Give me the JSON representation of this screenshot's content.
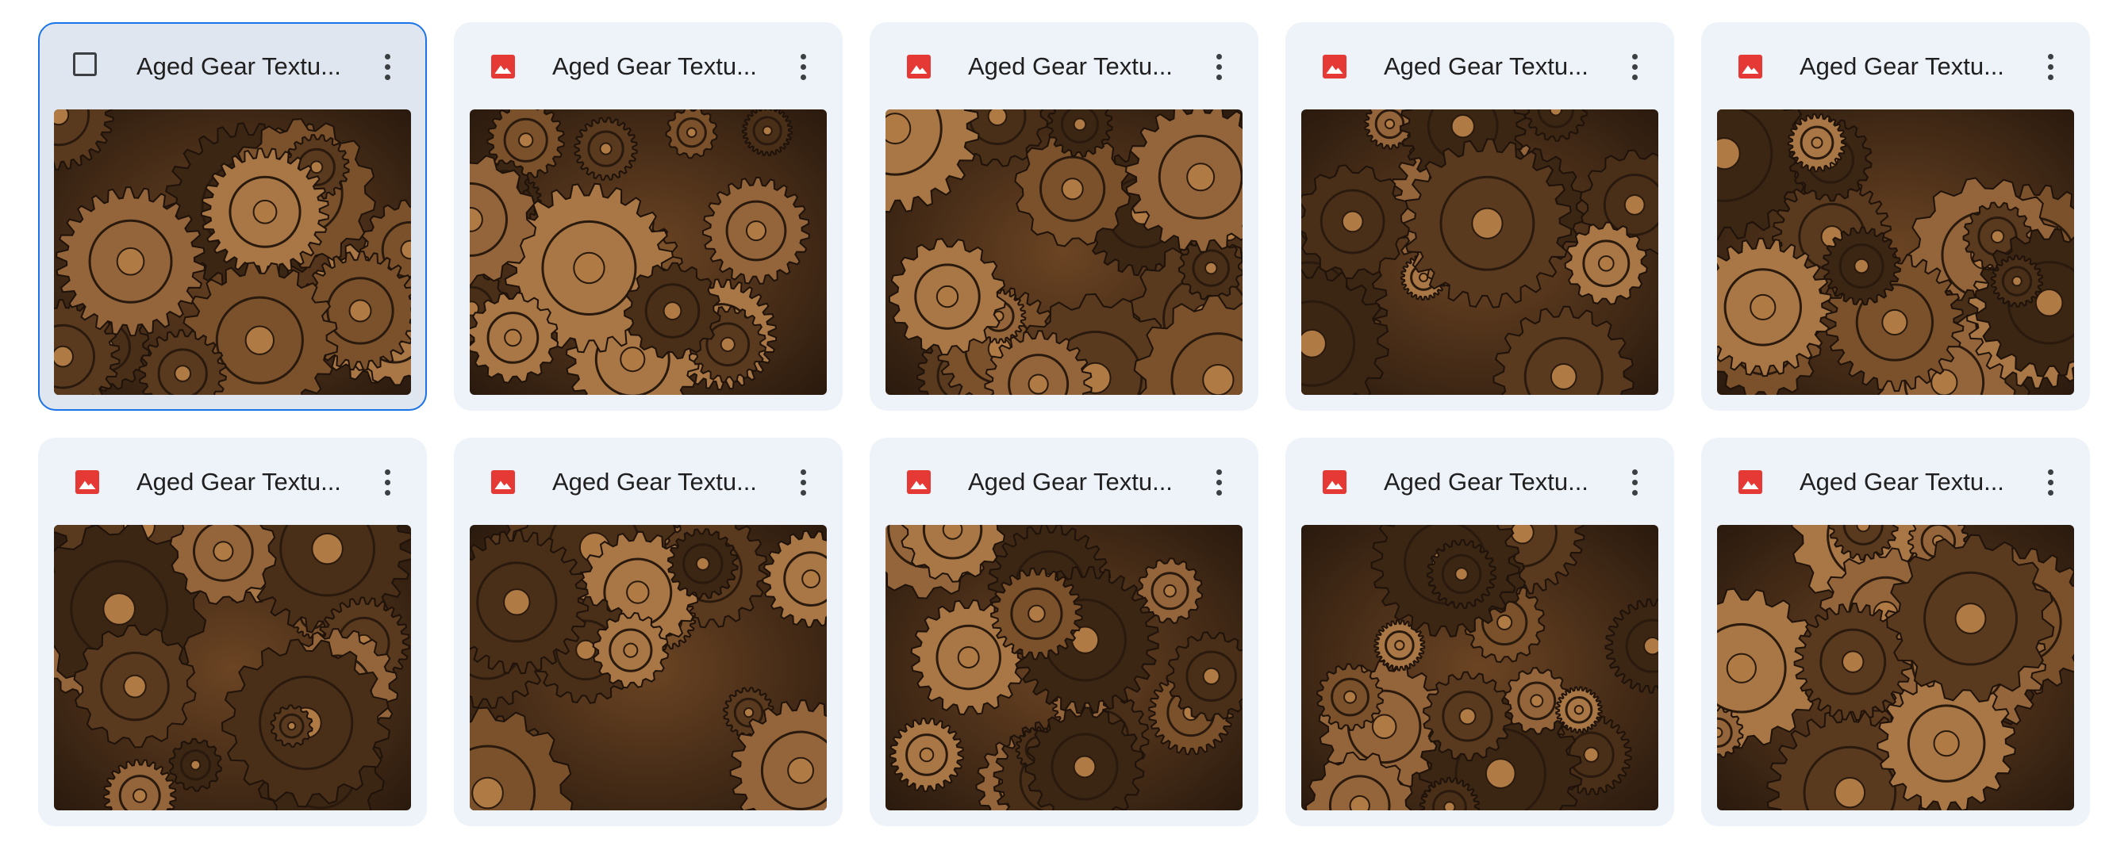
{
  "files": [
    {
      "name": "Aged Gear Textu...",
      "type": "image",
      "selected": true
    },
    {
      "name": "Aged Gear Textu...",
      "type": "image",
      "selected": false
    },
    {
      "name": "Aged Gear Textu...",
      "type": "image",
      "selected": false
    },
    {
      "name": "Aged Gear Textu...",
      "type": "image",
      "selected": false
    },
    {
      "name": "Aged Gear Textu...",
      "type": "image",
      "selected": false
    },
    {
      "name": "Aged Gear Textu...",
      "type": "image",
      "selected": false
    },
    {
      "name": "Aged Gear Textu...",
      "type": "image",
      "selected": false
    },
    {
      "name": "Aged Gear Textu...",
      "type": "image",
      "selected": false
    },
    {
      "name": "Aged Gear Textu...",
      "type": "image",
      "selected": false
    },
    {
      "name": "Aged Gear Textu...",
      "type": "image",
      "selected": false
    }
  ],
  "colors": {
    "card_bg": "#eef2f9",
    "card_selected_bg": "#e0e6ef",
    "selection_border": "#1a73e8",
    "image_icon": "#e53935",
    "thumb_dark": "#2a1a0e",
    "thumb_mid": "#6b4423",
    "thumb_light": "#b07a45"
  },
  "icons": {
    "file_type": "image-file-icon",
    "select": "checkbox-icon",
    "more": "more-vert-icon"
  }
}
